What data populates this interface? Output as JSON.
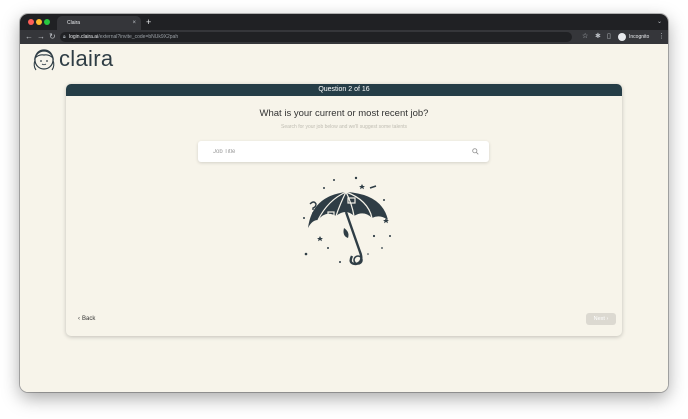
{
  "browser": {
    "tab_title": "Claira",
    "tab_close": "×",
    "new_tab": "+",
    "url_host": "login.claira.ai",
    "url_path": "/external?invite_code=bNUk9X2pah",
    "profile_label": "Incognito"
  },
  "app": {
    "brand": "claira"
  },
  "question": {
    "progress": "Question 2 of 16",
    "current": 2,
    "total": 16,
    "title": "What is your current or most recent job?",
    "hint": "Search for your job below and we'll suggest some talents"
  },
  "search": {
    "placeholder": "Job Title",
    "value": ""
  },
  "nav": {
    "back_label": "Back",
    "next_label": "Next",
    "next_enabled": false
  },
  "colors": {
    "header": "#253d47",
    "background": "#f7f4ea",
    "brand_text": "#2f3d45",
    "next_disabled": "#dcd9d1"
  },
  "icons": [
    "search-icon",
    "umbrella-illustration",
    "chevron-left-icon",
    "chevron-right-icon",
    "lock-icon",
    "star-icon",
    "extension-icon",
    "incognito-icon"
  ]
}
